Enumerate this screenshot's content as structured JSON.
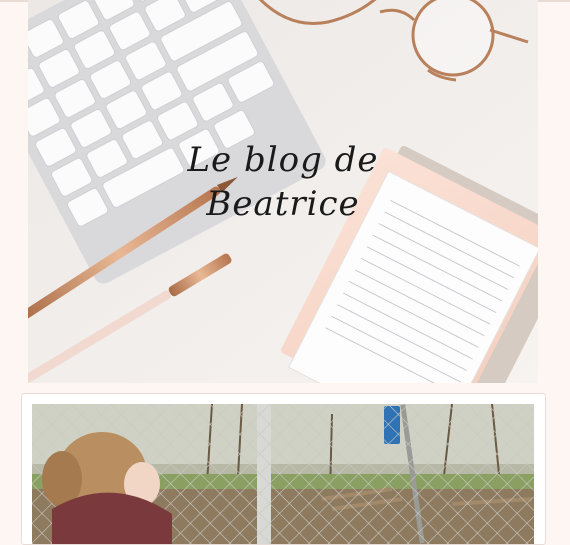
{
  "header": {
    "title_line1": "Le blog de",
    "title_line2": "Beatrice"
  },
  "icons": {
    "banner_image": "desk-flatlay-image",
    "post_image": "woman-fence-photo"
  },
  "colors": {
    "background": "#fdf6f3",
    "card_border": "#e7dcd7",
    "accent_rose_gold": "#c98a62"
  }
}
